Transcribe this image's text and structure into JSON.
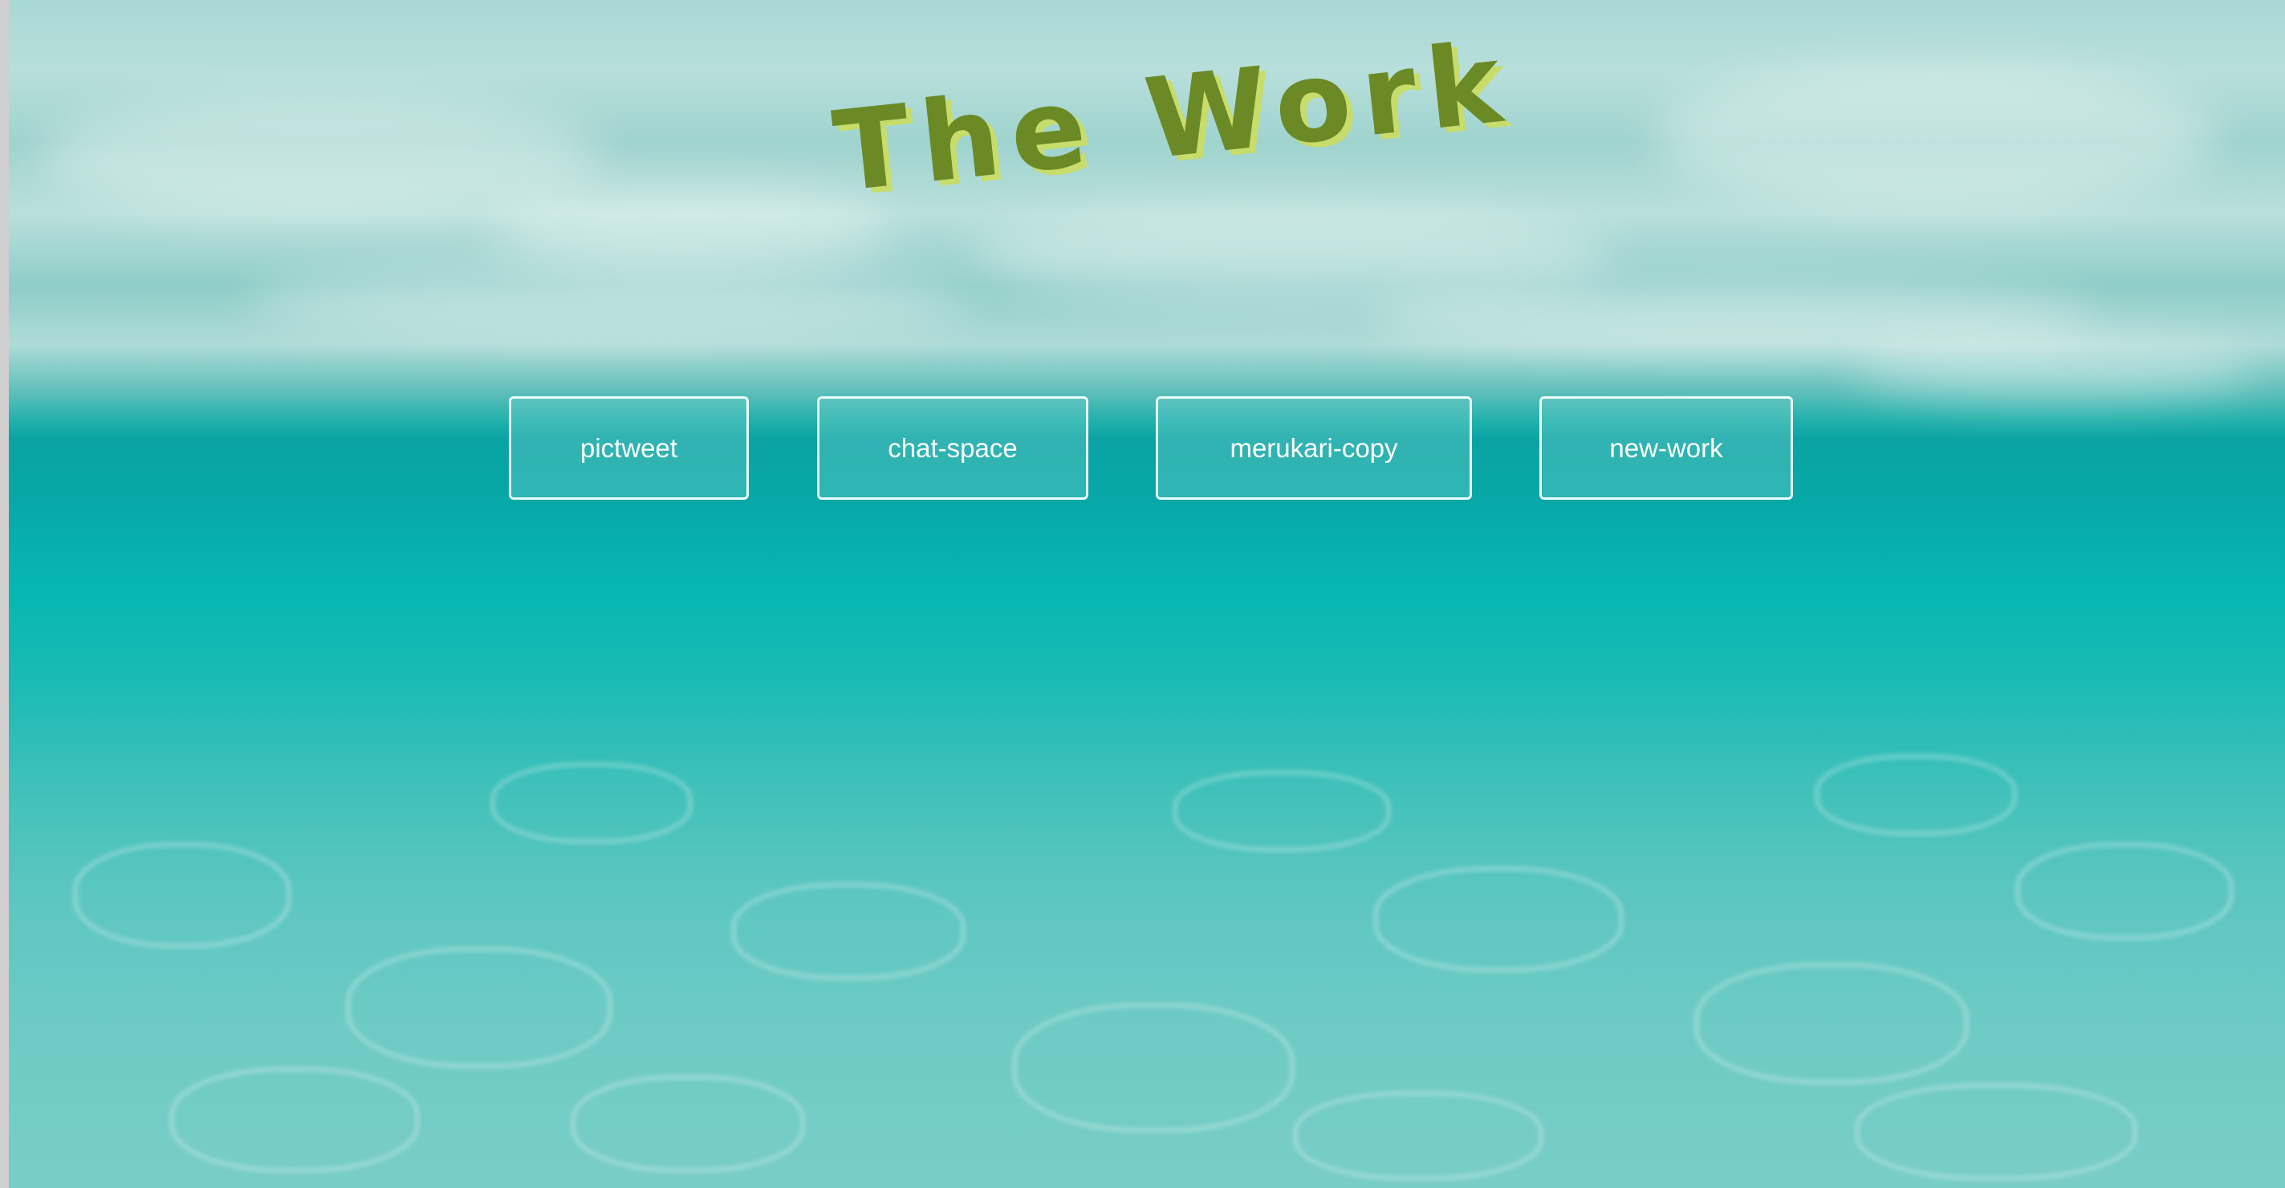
{
  "page": {
    "title": "The Work"
  },
  "nav": {
    "items": [
      {
        "label": "pictweet"
      },
      {
        "label": "chat-space"
      },
      {
        "label": "merukari-copy"
      },
      {
        "label": "new-work"
      }
    ]
  },
  "colors": {
    "title": "#6b8a25",
    "title_shadow": "#c7dc6a",
    "button_border": "#eafcfa",
    "water_deep": "#07a8a7",
    "water_light": "#79cdc7"
  }
}
